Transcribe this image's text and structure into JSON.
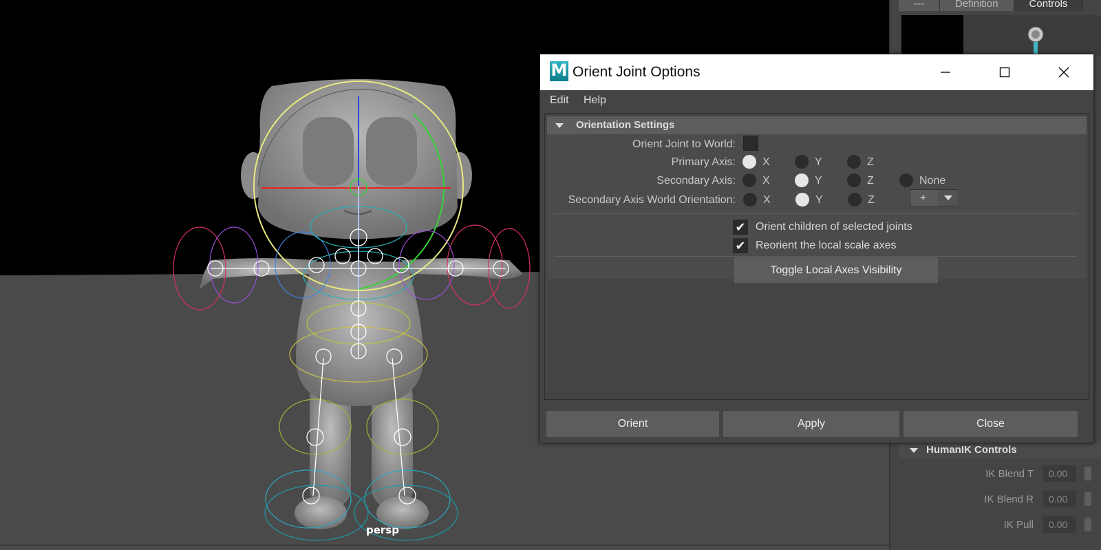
{
  "viewport": {
    "camera_label": "persp"
  },
  "side_panel": {
    "tabs": [
      {
        "label": "---"
      },
      {
        "label": "Definition"
      },
      {
        "label": "Controls"
      }
    ],
    "humanik": {
      "title": "HumanIK Controls",
      "rows": [
        {
          "label": "IK Blend T",
          "value": "0.00"
        },
        {
          "label": "IK Blend R",
          "value": "0.00"
        },
        {
          "label": "IK Pull",
          "value": "0.00"
        }
      ]
    }
  },
  "dialog": {
    "title": "Orient Joint Options",
    "app_icon": "M",
    "menu": {
      "edit": "Edit",
      "help": "Help"
    },
    "section_title": "Orientation Settings",
    "orient_world_label": "Orient Joint to World:",
    "primary_axis": {
      "label": "Primary Axis:",
      "options": [
        "X",
        "Y",
        "Z"
      ],
      "selected": "X"
    },
    "secondary_axis": {
      "label": "Secondary Axis:",
      "options": [
        "X",
        "Y",
        "Z",
        "None"
      ],
      "selected": "Y"
    },
    "secondary_world": {
      "label": "Secondary Axis World Orientation:",
      "options": [
        "X",
        "Y",
        "Z"
      ],
      "selected": "Y",
      "sign": "+"
    },
    "orient_children": {
      "label": "Orient children of selected joints",
      "checked": true
    },
    "reorient_scale": {
      "label": "Reorient the local scale axes",
      "checked": true
    },
    "toggle_button": "Toggle Local Axes Visibility",
    "buttons": {
      "orient": "Orient",
      "apply": "Apply",
      "close": "Close"
    }
  },
  "colors": {
    "viewport_bg": "#000000",
    "floor": "#4a4a4a",
    "ui_panel": "#444444",
    "title_bar": "#ffffff",
    "radio_on": "#e6e6e6"
  }
}
